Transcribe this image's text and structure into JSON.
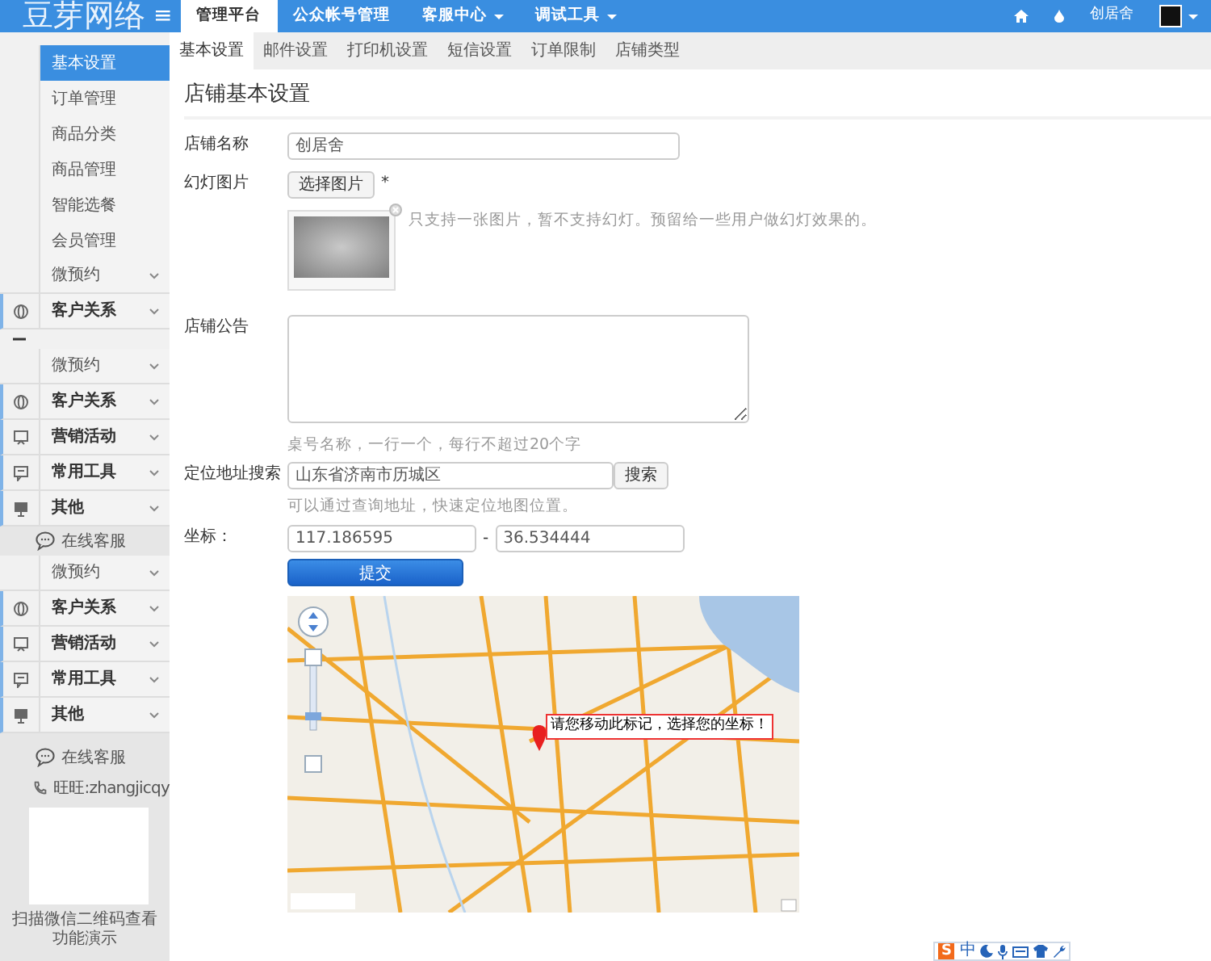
{
  "topbar": {
    "logo": "豆芽网络",
    "menu_glyph": "≡",
    "nav": [
      {
        "label": "管理平台",
        "selected": true,
        "dropdown": false
      },
      {
        "label": "公众帐号管理",
        "selected": false,
        "dropdown": false
      },
      {
        "label": "客服中心",
        "selected": false,
        "dropdown": true
      },
      {
        "label": "调试工具",
        "selected": false,
        "dropdown": true
      }
    ],
    "user": "创居舍"
  },
  "subnav": [
    {
      "label": "基本设置",
      "selected": true
    },
    {
      "label": "邮件设置",
      "selected": false
    },
    {
      "label": "打印机设置",
      "selected": false
    },
    {
      "label": "短信设置",
      "selected": false
    },
    {
      "label": "订单限制",
      "selected": false
    },
    {
      "label": "店铺类型",
      "selected": false
    }
  ],
  "sidebar": {
    "items": [
      {
        "kind": "link",
        "label": "基本设置",
        "selected": true
      },
      {
        "kind": "link",
        "label": "订单管理",
        "selected": false
      },
      {
        "kind": "link",
        "label": "商品分类",
        "selected": false
      },
      {
        "kind": "link",
        "label": "商品管理",
        "selected": false
      },
      {
        "kind": "link",
        "label": "智能选餐",
        "selected": false
      },
      {
        "kind": "link",
        "label": "会员管理",
        "selected": false
      },
      {
        "kind": "plain",
        "label": "微预约"
      },
      {
        "kind": "globe",
        "label": "客户关系"
      },
      {
        "kind": "minus"
      },
      {
        "kind": "plain",
        "label": "微预约"
      },
      {
        "kind": "globe",
        "label": "客户关系"
      },
      {
        "kind": "board",
        "label": "营销活动"
      },
      {
        "kind": "note",
        "label": "常用工具"
      },
      {
        "kind": "screen",
        "label": "其他"
      },
      {
        "kind": "service",
        "label": "在线客服"
      },
      {
        "kind": "plain",
        "label": "微预约"
      },
      {
        "kind": "globe",
        "label": "客户关系"
      },
      {
        "kind": "board",
        "label": "营销活动"
      },
      {
        "kind": "note",
        "label": "常用工具"
      },
      {
        "kind": "screen",
        "label": "其他"
      }
    ],
    "footer": {
      "service": "在线客服",
      "contact": "旺旺:zhangjicqy",
      "qr_caption": "扫描微信二维码查看功能演示"
    }
  },
  "form": {
    "title": "店铺基本设置",
    "store_name": {
      "label": "店铺名称",
      "value": "创居舍"
    },
    "slideshow": {
      "label": "幻灯图片",
      "button": "选择图片",
      "required_mark": "*",
      "hint": "只支持一张图片，暂不支持幻灯。预留给一些用户做幻灯效果的。"
    },
    "notice": {
      "label": "店铺公告",
      "hint": "桌号名称，一行一个，每行不超过20个字"
    },
    "address": {
      "label": "定位地址搜索",
      "value": "山东省济南市历城区",
      "button": "搜索",
      "hint": "可以通过查询地址，快速定位地图位置。"
    },
    "coords": {
      "label": "坐标：",
      "lng": "117.186595",
      "separator": "-",
      "lat": "36.534444"
    },
    "submit": "提交",
    "map": {
      "tooltip": "请您移动此标记，选择您的坐标！"
    }
  },
  "ime_toolbar": {
    "logo": "S",
    "mode": "中"
  }
}
